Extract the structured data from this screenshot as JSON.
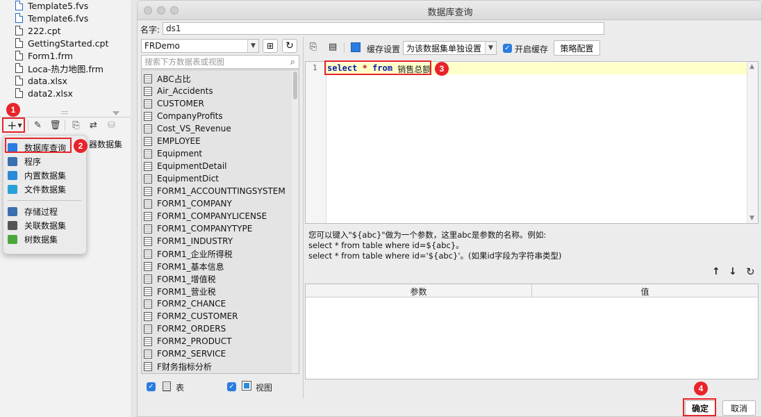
{
  "left_panel": {
    "files": [
      {
        "name": "Template5.fvs",
        "type": "fvs"
      },
      {
        "name": "Template6.fvs",
        "type": "fvs"
      },
      {
        "name": "222.cpt",
        "type": "cpt"
      },
      {
        "name": "GettingStarted.cpt",
        "type": "cpt"
      },
      {
        "name": "Form1.frm",
        "type": "frm"
      },
      {
        "name": "Loca-热力地图.frm",
        "type": "frm"
      },
      {
        "name": "data.xlsx",
        "type": "xlsx"
      },
      {
        "name": "data2.xlsx",
        "type": "xlsx"
      }
    ],
    "toolbar": {
      "add_icon": "plus-icon",
      "edit_icon": "pencil-icon",
      "delete_icon": "trash-icon",
      "preview_icon": "preview-icon",
      "switch_icon": "switch-icon",
      "db_icon": "database-icon"
    },
    "behind_text": "器数据集",
    "menu": {
      "items": [
        {
          "label": "数据库查询",
          "icon": "database-icon",
          "color": "#2a7ce0"
        },
        {
          "label": "程序",
          "icon": "program-icon",
          "color": "#3a6fb0"
        },
        {
          "label": "内置数据集",
          "icon": "builtin-dataset-icon",
          "color": "#2a8ad8"
        },
        {
          "label": "文件数据集",
          "icon": "file-dataset-icon",
          "color": "#2aa0d8"
        },
        {
          "label": "存储过程",
          "icon": "procedure-icon",
          "color": "#3a6fb0"
        },
        {
          "label": "关联数据集",
          "icon": "relation-dataset-icon",
          "color": "#555555"
        },
        {
          "label": "树数据集",
          "icon": "tree-icon",
          "color": "#4aa83a"
        }
      ]
    }
  },
  "dialog": {
    "title": "数据库查询",
    "name_label": "名字:",
    "name_value": "ds1",
    "datasource": "FRDemo",
    "search_placeholder": "搜索下方数据表或视图",
    "tables": [
      "ABC占比",
      "Air_Accidents",
      "CUSTOMER",
      "CompanyProfits",
      "Cost_VS_Revenue",
      "EMPLOYEE",
      "Equipment",
      "EquipmentDetail",
      "EquipmentDict",
      "FORM1_ACCOUNTTINGSYSTEM",
      "FORM1_COMPANY",
      "FORM1_COMPANYLICENSE",
      "FORM1_COMPANYTYPE",
      "FORM1_INDUSTRY",
      "FORM1_企业所得税",
      "FORM1_基本信息",
      "FORM1_增值税",
      "FORM1_营业税",
      "FORM2_CHANCE",
      "FORM2_CUSTOMER",
      "FORM2_ORDERS",
      "FORM2_PRODUCT",
      "FORM2_SERVICE",
      "F财务指标分析"
    ],
    "filter": {
      "table_label": "表",
      "view_label": "视图"
    },
    "query_toolbar": {
      "cache_settings": "缓存设置",
      "cache_option": "为该数据集单独设置",
      "enable_cache": "开启缓存",
      "strategy": "策略配置"
    },
    "editor": {
      "line_number": "1",
      "tokens": [
        {
          "text": "select",
          "style": "kw"
        },
        {
          "text": " ",
          "style": ""
        },
        {
          "text": "*",
          "style": "st"
        },
        {
          "text": " ",
          "style": ""
        },
        {
          "text": "from",
          "style": "kw"
        },
        {
          "text": " 销售总额",
          "style": ""
        }
      ]
    },
    "hint_lines": [
      "您可以键入\"${abc}\"做为一个参数，这里abc是参数的名称。例如:",
      "select * from table where id=${abc}。",
      "select * from table where id='${abc}'。(如果id字段为字符串类型)"
    ],
    "param_table": {
      "col_param": "参数",
      "col_value": "值"
    },
    "ok": "确定",
    "cancel": "取消"
  },
  "annotations": {
    "b1": "1",
    "b2": "2",
    "b3": "3",
    "b4": "4",
    "color": "#e8232a"
  }
}
